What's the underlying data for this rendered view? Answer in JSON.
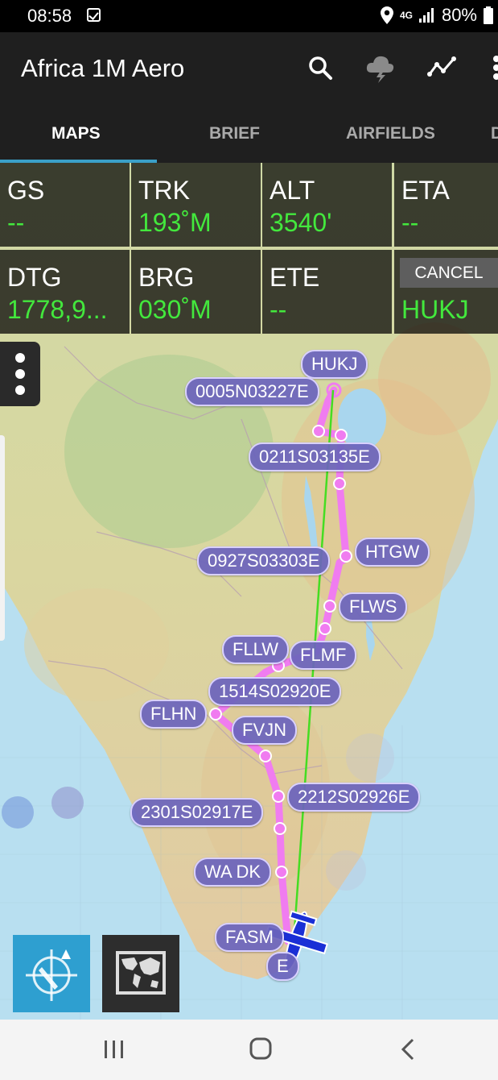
{
  "status_bar": {
    "time": "08:58",
    "network": "4G",
    "battery": "80%"
  },
  "app_bar": {
    "title": "Africa 1M Aero"
  },
  "tabs": [
    {
      "label": "MAPS"
    },
    {
      "label": "BRIEF"
    },
    {
      "label": "AIRFIELDS"
    },
    {
      "label": "D"
    }
  ],
  "nav_data": {
    "gs": {
      "label": "GS",
      "value": "--"
    },
    "trk": {
      "label": "TRK",
      "value": "193˚M"
    },
    "alt": {
      "label": "ALT",
      "value": "3540'"
    },
    "eta": {
      "label": "ETA",
      "value": "--"
    },
    "dtg": {
      "label": "DTG",
      "value": "1778,9..."
    },
    "brg": {
      "label": "BRG",
      "value": "030˚M"
    },
    "ete": {
      "label": "ETE",
      "value": "--"
    },
    "destination": {
      "cancel_label": "CANCEL",
      "value": "HUKJ"
    }
  },
  "waypoints": [
    {
      "label": "HUKJ"
    },
    {
      "label": "0005N03227E"
    },
    {
      "label": "0211S03135E"
    },
    {
      "label": "HTGW"
    },
    {
      "label": "0927S03303E"
    },
    {
      "label": "FLWS"
    },
    {
      "label": "FLLW"
    },
    {
      "label": "FLMF"
    },
    {
      "label": "1514S02920E"
    },
    {
      "label": "FLHN"
    },
    {
      "label": "FVJN"
    },
    {
      "label": "2212S02926E"
    },
    {
      "label": "2301S02917E"
    },
    {
      "label": "WA DK"
    },
    {
      "label": "FASM"
    },
    {
      "label": "E"
    }
  ],
  "colors": {
    "accent": "#3aa0c8",
    "data_value": "#43e83d",
    "route": "#f07cf0",
    "direct_line": "#44dd22",
    "aircraft": "#1a2fd6"
  },
  "icons": {
    "search": "search-icon",
    "weather": "weather-cloud-icon",
    "profile": "elevation-profile-icon",
    "overflow": "overflow-menu-icon",
    "layers": "layers-menu-icon",
    "track_up": "track-up-compass-icon",
    "map_view": "world-map-icon"
  }
}
